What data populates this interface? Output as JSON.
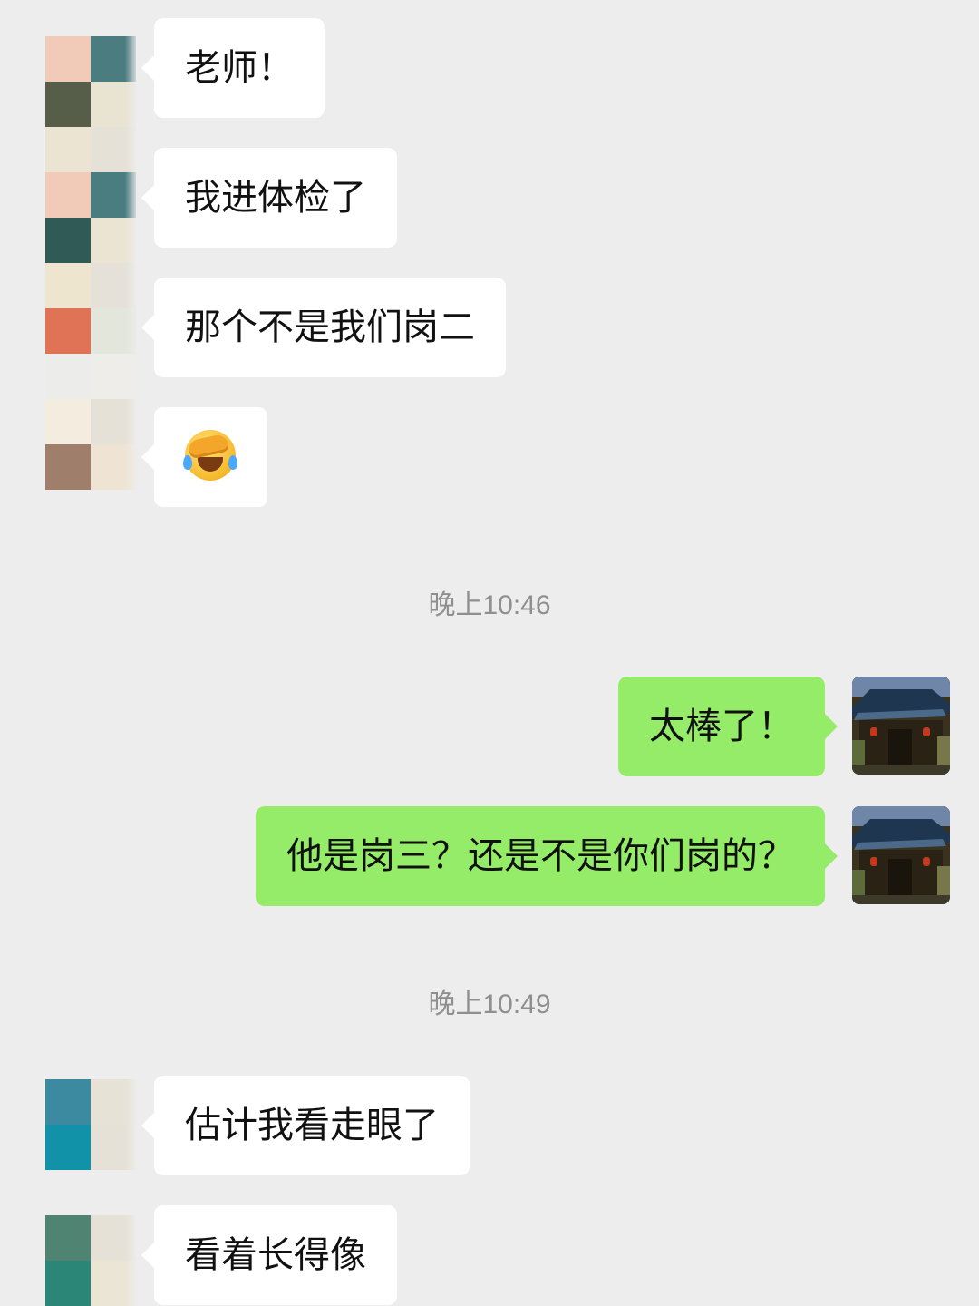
{
  "chat": {
    "messages": [
      {
        "from": "other",
        "text": "老师！"
      },
      {
        "from": "other",
        "text": "我进体检了"
      },
      {
        "from": "other",
        "text": "那个不是我们岗二"
      },
      {
        "from": "other",
        "emoji": "face-palm-crying-emoji"
      },
      {
        "from": "self",
        "text": "太棒了！"
      },
      {
        "from": "self",
        "text": "他是岗三？还是不是你们岗的？"
      },
      {
        "from": "other",
        "text": "估计我看走眼了"
      },
      {
        "from": "other",
        "text": "看着长得像"
      }
    ],
    "timestamps": [
      "晚上10:46",
      "晚上10:49"
    ]
  },
  "colors": {
    "background": "#ededed",
    "incoming_bubble": "#ffffff",
    "outgoing_bubble": "#95ec69",
    "timestamp_text": "#8f8f8f"
  },
  "icons": {
    "other_avatar": "pixelated-avatar",
    "self_avatar": "temple-building-photo-avatar"
  }
}
